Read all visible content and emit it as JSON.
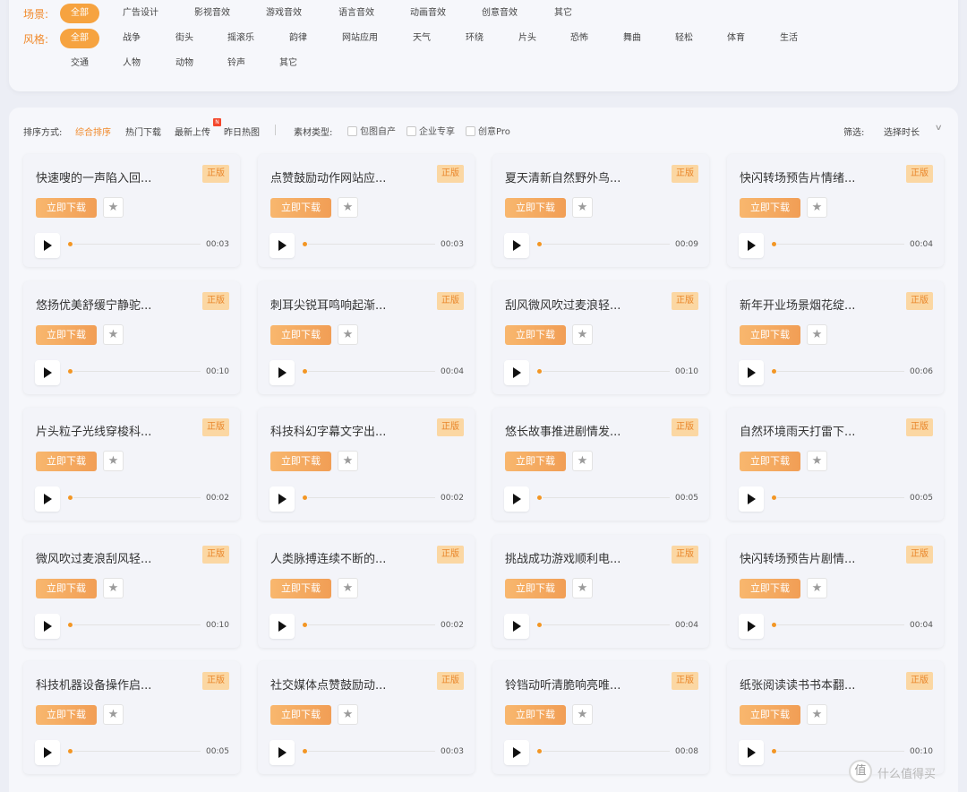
{
  "scene_filter": {
    "label": "场景:",
    "items": [
      "全部",
      "广告设计",
      "影视音效",
      "游戏音效",
      "语言音效",
      "动画音效",
      "创意音效",
      "其它"
    ],
    "active_index": 0
  },
  "style_filter": {
    "label": "风格:",
    "items": [
      "全部",
      "战争",
      "街头",
      "摇滚乐",
      "韵律",
      "网站应用",
      "天气",
      "环绕",
      "片头",
      "恐怖",
      "舞曲",
      "轻松",
      "体育",
      "生活",
      "交通",
      "人物",
      "动物",
      "铃声",
      "其它"
    ],
    "active_index": 0
  },
  "toolbar": {
    "sort_label": "排序方式:",
    "sort_options": [
      "综合排序",
      "热门下载",
      "最新上传",
      "昨日热图"
    ],
    "sort_active_index": 0,
    "new_badge": "N",
    "type_label": "素材类型:",
    "type_checkboxes": [
      "包图自产",
      "企业专享",
      "创意Pro"
    ],
    "filter_label": "筛选:",
    "duration_select": "选择时长"
  },
  "card_labels": {
    "badge": "正版",
    "download": "立即下载"
  },
  "colors": {
    "accent": "#f18a2b",
    "active_chip": "#f6a340",
    "badge_bg": "#fbd7a3"
  },
  "cards": [
    {
      "title": "快速嗖的一声陷入回...",
      "duration": "00:03"
    },
    {
      "title": "点赞鼓励动作网站应...",
      "duration": "00:03"
    },
    {
      "title": "夏天清新自然野外鸟...",
      "duration": "00:09"
    },
    {
      "title": "快闪转场预告片情绪...",
      "duration": "00:04"
    },
    {
      "title": "悠扬优美舒缓宁静驼...",
      "duration": "00:10"
    },
    {
      "title": "刺耳尖锐耳鸣响起渐...",
      "duration": "00:04"
    },
    {
      "title": "刮风微风吹过麦浪轻...",
      "duration": "00:10"
    },
    {
      "title": "新年开业场景烟花绽...",
      "duration": "00:06"
    },
    {
      "title": "片头粒子光线穿梭科...",
      "duration": "00:02"
    },
    {
      "title": "科技科幻字幕文字出...",
      "duration": "00:02"
    },
    {
      "title": "悠长故事推进剧情发...",
      "duration": "00:05"
    },
    {
      "title": "自然环境雨天打雷下...",
      "duration": "00:05"
    },
    {
      "title": "微风吹过麦浪刮风轻...",
      "duration": "00:10"
    },
    {
      "title": "人类脉搏连续不断的...",
      "duration": "00:02"
    },
    {
      "title": "挑战成功游戏顺利电...",
      "duration": "00:04"
    },
    {
      "title": "快闪转场预告片剧情...",
      "duration": "00:04"
    },
    {
      "title": "科技机器设备操作启...",
      "duration": "00:05"
    },
    {
      "title": "社交媒体点赞鼓励动...",
      "duration": "00:03"
    },
    {
      "title": "铃铛动听清脆响亮唯...",
      "duration": "00:08"
    },
    {
      "title": "纸张阅读读书书本翻...",
      "duration": "00:10"
    }
  ],
  "watermark": {
    "logo": "值",
    "text": "什么值得买"
  }
}
